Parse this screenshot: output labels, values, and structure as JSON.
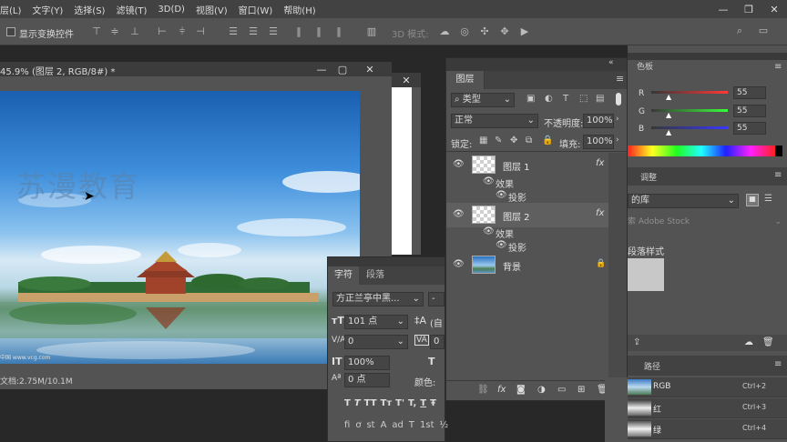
{
  "menu": [
    "层(L)",
    "文字(Y)",
    "选择(S)",
    "滤镜(T)",
    "3D(D)",
    "视图(V)",
    "窗口(W)",
    "帮助(H)"
  ],
  "options_bar": {
    "transform_controls_label": "显示变换控件",
    "mode_3d_label": "3D 模式:"
  },
  "document": {
    "title": "45.9% (图层 2, RGB/8#) *",
    "watermark": "苏漫教育",
    "credit": "中国 www.vcg.com",
    "footer": "文档:2.75M/10.1M"
  },
  "layers_panel": {
    "tab": "图层",
    "filter_kind": "类型",
    "blend_mode": "正常",
    "opacity_label": "不透明度:",
    "opacity_value": "100%",
    "lock_label": "锁定:",
    "fill_label": "填充:",
    "fill_value": "100%",
    "layers": [
      {
        "name": "图层 1",
        "fx": "fx",
        "effects_label": "效果",
        "effect": "投影"
      },
      {
        "name": "图层 2",
        "fx": "fx",
        "effects_label": "效果",
        "effect": "投影"
      },
      {
        "name": "背景"
      }
    ],
    "footer_fx": "fx"
  },
  "character_panel": {
    "tabs": [
      "字符",
      "段落"
    ],
    "font_family": "方正兰亭中黑...",
    "font_style": "-",
    "font_size": "101 点",
    "leading": "(自",
    "kerning": "0",
    "tracking": "0",
    "vscale": "100%",
    "baseline": "0 点",
    "color_label": "颜色:",
    "style_buttons": [
      "T",
      "T",
      "TT",
      "Tт",
      "T'",
      "T,",
      "T",
      "Ŧ"
    ],
    "opentype_buttons": [
      "fi",
      "ơ",
      "st",
      "A",
      "ad",
      "T",
      "1st",
      "½"
    ]
  },
  "color_panel": {
    "tab": "色板",
    "channels": [
      {
        "label": "R",
        "value": "55"
      },
      {
        "label": "G",
        "value": "55"
      },
      {
        "label": "B",
        "value": "55"
      }
    ]
  },
  "adjust_panel": {
    "tab": "调整",
    "library": "的库",
    "stock_placeholder": "索 Adobe Stock",
    "styles_label": "段落样式"
  },
  "channels_panel": {
    "tab": "路径",
    "rows": [
      {
        "name": "RGB",
        "shortcut": "Ctrl+2"
      },
      {
        "name": "红",
        "shortcut": "Ctrl+3"
      },
      {
        "name": "绿",
        "shortcut": "Ctrl+4"
      }
    ]
  },
  "colors": {
    "panel_bg": "#535353",
    "dark_bg": "#282828",
    "accent": "#3a3a3a"
  }
}
